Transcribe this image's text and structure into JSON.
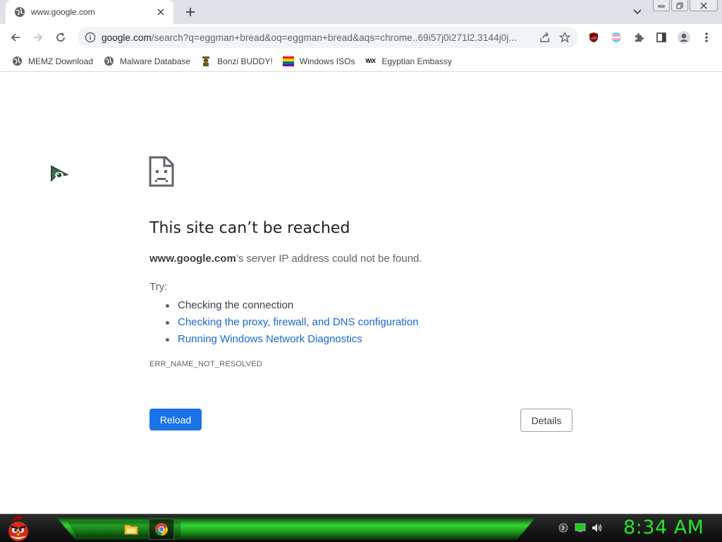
{
  "tab": {
    "title": "www.google.com",
    "favicon": "globe-icon"
  },
  "omnibox": {
    "host": "google.com",
    "path": "/search?q=eggman+bread&oq=eggman+bread&aqs=chrome..69i57j0i271l2.3144j0j..."
  },
  "bookmarks": [
    {
      "label": "MEMZ Download",
      "icon": "globe-icon"
    },
    {
      "label": "Malware Database",
      "icon": "globe-icon"
    },
    {
      "label": "Bonzi BUDDY!",
      "icon": "bonzi-icon"
    },
    {
      "label": "Windows ISOs",
      "icon": "rainbow-flag-icon"
    },
    {
      "label": "Egyptian Embassy",
      "icon": "wix-icon",
      "icon_text": "WiX"
    }
  ],
  "error": {
    "title": "This site can’t be reached",
    "host": "www.google.com",
    "desc_suffix": "’s server IP address could not be found.",
    "try_label": "Try:",
    "suggestions": [
      "Checking the connection",
      "Checking the proxy, firewall, and DNS configuration",
      "Running Windows Network Diagnostics"
    ],
    "code": "ERR_NAME_NOT_RESOLVED",
    "reload_label": "Reload",
    "details_label": "Details"
  },
  "taskbar": {
    "clock": "8:34 AM",
    "clock_color": "#22e822"
  },
  "colors": {
    "link": "#1967d2",
    "primary_button": "#1a73e8",
    "tabstrip": "#dee1e6",
    "omnibox": "#f1f3f4"
  }
}
